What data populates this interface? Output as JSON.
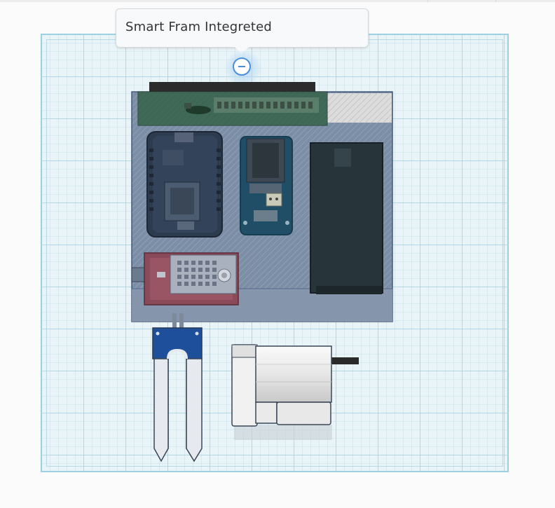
{
  "tooltip": {
    "label": "Smart Fram Integreted"
  },
  "icons": {
    "collapse": "minus-circle-icon"
  },
  "colors": {
    "workplane": "#e9f4f8",
    "workplane_border": "#9fd0e2",
    "accent": "#4a8ede",
    "selection": "#6f87a8"
  }
}
